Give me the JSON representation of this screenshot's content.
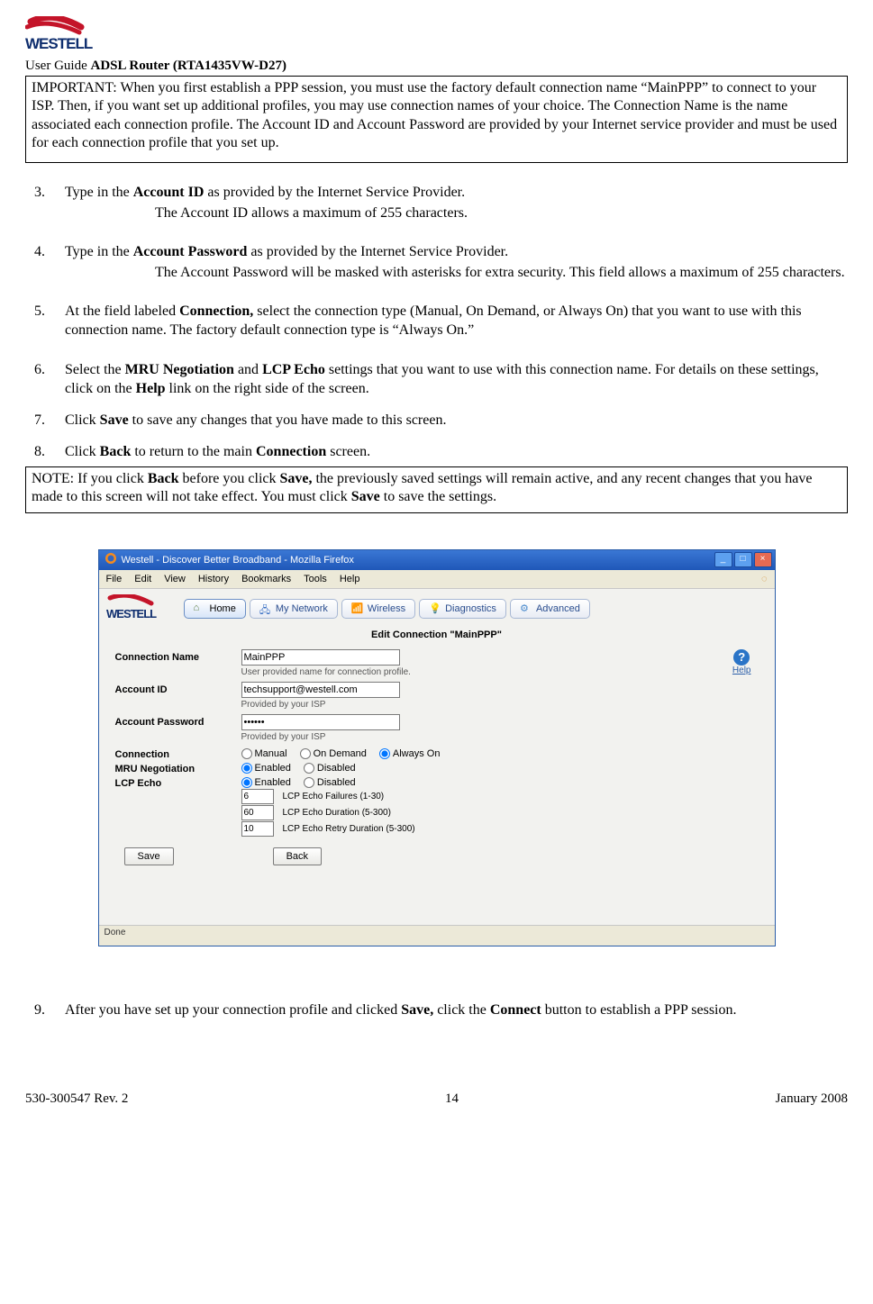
{
  "header": {
    "user_guide": "User Guide",
    "product": "ADSL Router (RTA1435VW-D27)"
  },
  "important_box": "IMPORTANT: When you first establish a PPP session, you must use the factory default connection name “MainPPP” to connect to your ISP. Then, if you want set up additional profiles, you may use connection names of your choice. The Connection Name is the name associated each connection profile. The Account ID and Account Password are provided by your Internet service provider and must be used for each connection profile that you set up.",
  "steps": {
    "s3": {
      "num": "3.",
      "text_pre": "Type in the ",
      "b1": "Account ID",
      "text_post": " as provided by the Internet Service Provider.",
      "sub": "The Account ID allows a maximum of 255 characters."
    },
    "s4": {
      "num": "4.",
      "text_pre": "Type in the ",
      "b1": "Account Password",
      "text_post": " as provided by the Internet Service Provider.",
      "sub": "The Account Password will be masked with asterisks for extra security. This field allows a maximum of 255 characters."
    },
    "s5": {
      "num": "5.",
      "text_pre": "At the field labeled ",
      "b1": "Connection,",
      "text_post": " select the connection type (Manual, On Demand, or Always On) that you want to use with this connection name. The factory default connection type is  “Always On.”"
    },
    "s6": {
      "num": "6.",
      "text_pre": "Select the ",
      "b1": "MRU Negotiation",
      "mid": " and ",
      "b2": "LCP Echo",
      "text_post": " settings that you want to use with this connection name. For details on these settings, click on the ",
      "b3": "Help",
      "tail": " link on the right side of the screen."
    },
    "s7": {
      "num": "7.",
      "text_pre": "Click ",
      "b1": "Save",
      "text_post": " to save any changes that you have made to this screen."
    },
    "s8": {
      "num": "8.",
      "text_pre": "Click ",
      "b1": "Back",
      "text_post": " to return to the main ",
      "b2": "Connection",
      "tail": " screen."
    },
    "s9": {
      "num": "9.",
      "text_pre": "After you have set up your connection profile and clicked ",
      "b1": "Save,",
      "mid": " click the ",
      "b2": "Connect",
      "text_post": " button to establish a PPP session."
    }
  },
  "note_box": {
    "pre": "NOTE: If you click ",
    "b1": "Back",
    "mid1": " before you click ",
    "b2": "Save,",
    "mid2": " the previously saved settings will remain active, and any recent changes that you have made to this screen will not take effect. You must click  ",
    "b3": "Save",
    "post": " to save the settings."
  },
  "screenshot": {
    "window_title": "Westell - Discover Better Broadband - Mozilla Firefox",
    "menubar": [
      "File",
      "Edit",
      "View",
      "History",
      "Bookmarks",
      "Tools",
      "Help"
    ],
    "brand": "WESTELL",
    "tabs": [
      {
        "label": "Home",
        "icon": "home-icon",
        "active": true
      },
      {
        "label": "My Network",
        "icon": "network-icon"
      },
      {
        "label": "Wireless",
        "icon": "wireless-icon"
      },
      {
        "label": "Diagnostics",
        "icon": "diagnostics-icon"
      },
      {
        "label": "Advanced",
        "icon": "advanced-icon"
      }
    ],
    "panel_title": "Edit Connection \"MainPPP\"",
    "help_label": "Help",
    "form": {
      "connection_name": {
        "label": "Connection Name",
        "value": "MainPPP",
        "hint": "User provided name for connection profile."
      },
      "account_id": {
        "label": "Account ID",
        "value": "techsupport@westell.com",
        "hint": "Provided by your ISP"
      },
      "account_password": {
        "label": "Account Password",
        "value": "******",
        "hint": "Provided by your ISP"
      },
      "connection": {
        "label": "Connection",
        "options": [
          "Manual",
          "On Demand",
          "Always On"
        ],
        "selected": "Always On"
      },
      "mru": {
        "label": "MRU Negotiation",
        "options": [
          "Enabled",
          "Disabled"
        ],
        "selected": "Enabled"
      },
      "lcp": {
        "label": "LCP Echo",
        "options": [
          "Enabled",
          "Disabled"
        ],
        "selected": "Enabled",
        "failures": {
          "value": "6",
          "label": "LCP Echo Failures (1-30)"
        },
        "duration": {
          "value": "60",
          "label": "LCP Echo Duration (5-300)"
        },
        "retry": {
          "value": "10",
          "label": "LCP Echo Retry Duration (5-300)"
        }
      },
      "buttons": {
        "save": "Save",
        "back": "Back"
      }
    },
    "status": "Done"
  },
  "footer": {
    "left": "530-300547 Rev. 2",
    "center": "14",
    "right": "January 2008"
  }
}
